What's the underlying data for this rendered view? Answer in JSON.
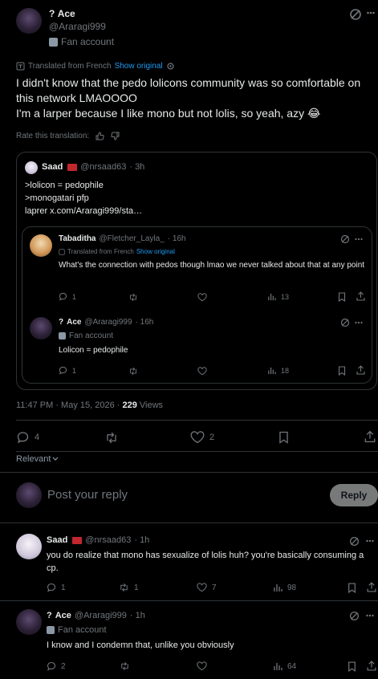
{
  "main_post": {
    "display_name": "Ace",
    "handle": "@Araragi999",
    "label": "Fan account",
    "translated_from": "Translated from French",
    "show_original": "Show original",
    "text_line1": "I didn't know that the pedo lolicons community was so comfortable on this network LMAOOOO",
    "text_line2": "I'm a larper because I like mono but not lolis, so yeah, azy 😂",
    "rate_translation": "Rate this translation:",
    "timestamp": "11:47 PM · May 15, 2026 ·",
    "views_count": "229",
    "views_label": "Views",
    "replies": "4",
    "likes": "2"
  },
  "quote": {
    "display_name": "Saad",
    "handle": "@nrsaad63",
    "time": "· 3h",
    "line1": ">lolicon = pedophile",
    "line2": ">monogatari pfp",
    "line3": "laprer  x.com/Araragi999/sta…"
  },
  "quote_reply1": {
    "display_name": "Tabaditha",
    "handle": "@Fletcher_Layla_",
    "time": "· 16h",
    "translated_from": "Translated from French",
    "show_original": "Show original",
    "text": "What's the connection with pedos though lmao we never talked about that at any point",
    "replies": "1",
    "views": "13"
  },
  "quote_reply2": {
    "display_name": "Ace",
    "handle": "@Araragi999",
    "time": "· 16h",
    "label": "Fan account",
    "text": "Lolicon = pedophile",
    "replies": "1",
    "views": "18"
  },
  "relevant": "Relevant",
  "composer": {
    "placeholder": "Post your reply",
    "button": "Reply"
  },
  "reply1": {
    "display_name": "Saad",
    "handle": "@nrsaad63",
    "time": "· 1h",
    "text": "you do realize that mono has sexualize of lolis huh? you're basically consuming a cp.",
    "replies": "1",
    "reposts": "1",
    "likes": "7",
    "views": "98"
  },
  "reply2": {
    "display_name": "Ace",
    "handle": "@Araragi999",
    "time": "· 1h",
    "label": "Fan account",
    "text": "I know and I condemn that, unlike you obviously",
    "replies": "2",
    "views": "64"
  }
}
